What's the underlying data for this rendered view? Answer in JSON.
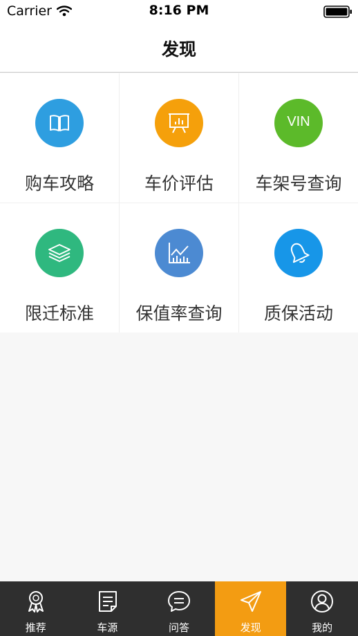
{
  "status_bar": {
    "carrier": "Carrier",
    "time": "8:16 PM"
  },
  "header": {
    "title": "发现"
  },
  "grid": [
    {
      "label": "购车攻略",
      "icon": "book-icon",
      "color": "#2e9ee0"
    },
    {
      "label": "车价评估",
      "icon": "presentation-board-icon",
      "color": "#f5a00b"
    },
    {
      "label": "车架号查询",
      "icon": "vin-icon",
      "icon_text": "VIN",
      "color": "#5cba2a"
    },
    {
      "label": "限迁标准",
      "icon": "layers-icon",
      "color": "#2fb87f"
    },
    {
      "label": "保值率查询",
      "icon": "line-chart-icon",
      "color": "#4c8ad2"
    },
    {
      "label": "质保活动",
      "icon": "bell-icon",
      "color": "#1796e8"
    }
  ],
  "tab_bar": {
    "active_color": "#f39c12",
    "items": [
      {
        "label": "推荐",
        "icon": "award-ribbon-icon",
        "active": false
      },
      {
        "label": "车源",
        "icon": "document-list-icon",
        "active": false
      },
      {
        "label": "问答",
        "icon": "chat-bubble-icon",
        "active": false
      },
      {
        "label": "发现",
        "icon": "paper-plane-icon",
        "active": true
      },
      {
        "label": "我的",
        "icon": "user-profile-icon",
        "active": false
      }
    ]
  }
}
